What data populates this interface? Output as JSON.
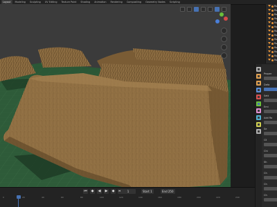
{
  "workspace_tabs": [
    "Layout",
    "Modeling",
    "Sculpting",
    "UV Editing",
    "Texture Paint",
    "Shading",
    "Animation",
    "Rendering",
    "Compositing",
    "Geometry Nodes",
    "Scripting"
  ],
  "active_workspace": "Layout",
  "outliner": {
    "rows": [
      "Ro",
      "Ro",
      "Ro",
      "Ro",
      "Ro",
      "Ro",
      "Ro",
      "Ro",
      "Ro",
      "Ro",
      "Ro",
      "Ro",
      "Ro",
      "Ro"
    ]
  },
  "viewport": {
    "scene": "thatched-roof-objects-on-grid",
    "colors": {
      "ground": "#2e5c3a",
      "thatch": "#8a6b3f",
      "background": "#3b3b3b",
      "gizmo_x": "#d94a4a",
      "gizmo_y": "#6bbf3b",
      "gizmo_z": "#4a7fd9"
    }
  },
  "properties": {
    "labels": [
      "Proper",
      "Defa",
      "Sett",
      "Emi",
      "Add Ro",
      "Se",
      "Cli",
      "Chi",
      "Sh",
      "Ch",
      "Ch",
      "Ch"
    ]
  },
  "timeline": {
    "current_frame": "1",
    "start_label": "Start",
    "start": "1",
    "end_label": "End",
    "end": "250",
    "ruler": [
      "0",
      "20",
      "40",
      "60",
      "80",
      "100",
      "120",
      "140",
      "160",
      "180",
      "200",
      "220",
      "240"
    ]
  }
}
